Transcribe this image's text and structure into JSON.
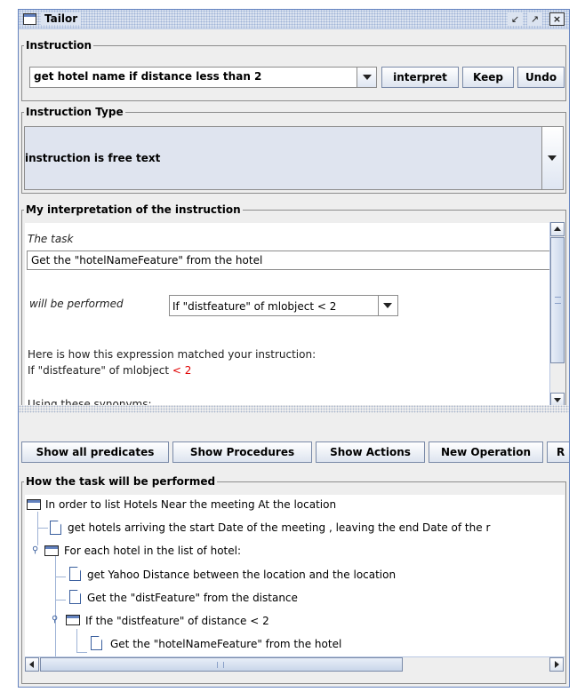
{
  "window": {
    "title": "Tailor"
  },
  "instruction": {
    "group_title": "Instruction",
    "value": "get hotel name if distance less than 2",
    "interpret_label": "interpret",
    "keep_label": "Keep",
    "undo_label": "Undo"
  },
  "instruction_type": {
    "group_title": "Instruction Type",
    "value": "instruction is free text"
  },
  "interpretation": {
    "group_title": "My interpretation of the instruction",
    "task_label": "The task",
    "task_value": "Get the \"hotelNameFeature\" from the hotel",
    "performed_label": "will be performed",
    "condition_value": "If \"distfeature\" of mlobject < 2",
    "match_intro": "Here is how this expression matched your instruction:",
    "match_prefix": "If \"distfeature\" of mlobject ",
    "match_highlight": "< 2",
    "synonyms_label": "Using these synonyms:"
  },
  "buttons": {
    "show_all_predicates": "Show all predicates",
    "show_procedures": "Show Procedures",
    "show_actions": "Show Actions",
    "new_operation": "New Operation",
    "cut_button": "R"
  },
  "tree": {
    "group_title": "How the task will be performed",
    "nodes": [
      "In order to list Hotels Near the meeting At the location",
      "get hotels arriving the start Date of the meeting , leaving the end Date of the r",
      "For each hotel in the list of hotel:",
      "get Yahoo Distance between the location and the location",
      "Get the \"distFeature\" from the distance",
      "If the \"distfeature\" of distance < 2",
      "Get the \"hotelNameFeature\" from the hotel"
    ]
  },
  "colors": {
    "accent": "#6382bf",
    "highlight": "#e00000"
  }
}
